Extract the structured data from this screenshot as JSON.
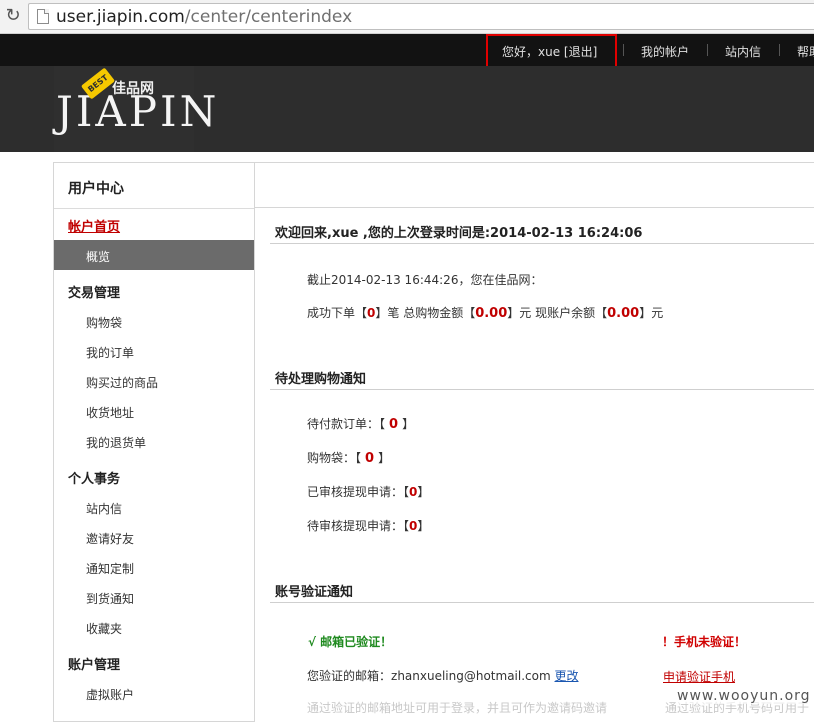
{
  "browser": {
    "url_host": "user.jiapin.com",
    "url_path": "/center/centerindex"
  },
  "topbar": {
    "greeting": "您好，xue [退出]",
    "links": [
      "我的帐户",
      "站内信",
      "帮助"
    ]
  },
  "logo": {
    "best": "BEST",
    "cn": "佳品网",
    "mark": "JIAPIN"
  },
  "sidebar": {
    "title": "用户中心",
    "account_home": "帐户首页",
    "overview": "概览",
    "trade_title": "交易管理",
    "trade_items": [
      "购物袋",
      "我的订单",
      "购买过的商品",
      "收货地址",
      "我的退货单"
    ],
    "personal_title": "个人事务",
    "personal_items": [
      "站内信",
      "邀请好友",
      "通知定制",
      "到货通知",
      "收藏夹"
    ],
    "account_title": "账户管理",
    "account_items": [
      "虚拟账户"
    ]
  },
  "welcome": {
    "title": "欢迎回来,xue ,您的上次登录时间是:2014-02-13 16:24:06",
    "as_of": "截止2014-02-13 16:44:26，您在佳品网：",
    "orders_prefix": "成功下单【",
    "orders_count": "0",
    "orders_suffix": "】笔 总购物金额【",
    "total_amount": "0.00",
    "amount_suffix": "】元 现账户余额【",
    "balance": "0.00",
    "balance_suffix": "】元"
  },
  "pending": {
    "title": "待处理购物通知",
    "rows": [
      {
        "label": "待付款订单：【",
        "value": "0",
        "suffix": "】"
      },
      {
        "label": "购物袋：【",
        "value": "0",
        "suffix": "】"
      },
      {
        "label": "已审核提现申请：【",
        "value": "0",
        "suffix": "】"
      },
      {
        "label": "待审核提现申请：【",
        "value": "0",
        "suffix": "】"
      }
    ]
  },
  "verify": {
    "title": "账号验证通知",
    "email_status": "√ 邮箱已验证！",
    "phone_status": "！手机未验证！",
    "email_label": "您验证的邮箱：",
    "email": "zhanxueling@hotmail.com",
    "change": "更改",
    "phone_link": "申请验证手机",
    "faded_left": "通过验证的邮箱地址可用于登录，并且可作为邀请码邀请",
    "faded_right": "通过验证的手机号码可用于"
  },
  "watermark": "www.wooyun.org",
  "colors": {
    "topbar_bg": "#121212",
    "header_bg": "#2d2d2d",
    "highlight_box": "#e00000",
    "accent_red": "#c00000",
    "verified_green": "#1f8a1f",
    "sidebar_active_bg": "#6b6b6b"
  }
}
